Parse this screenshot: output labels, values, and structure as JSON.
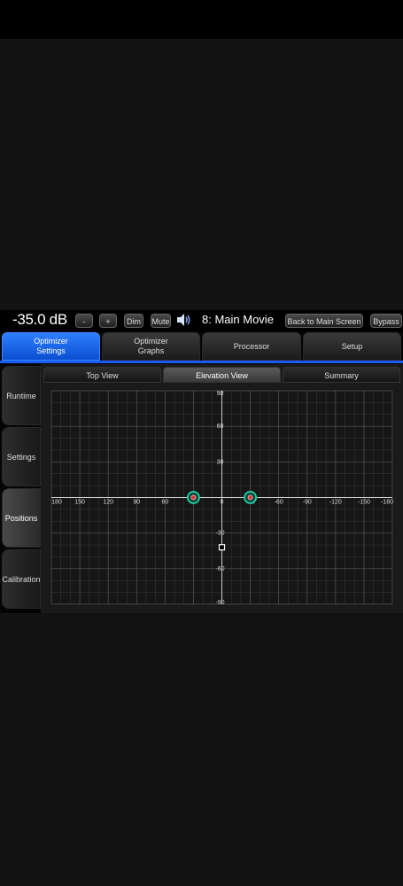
{
  "topbar": {
    "volume": "-35.0 dB",
    "minus_label": "-",
    "plus_label": "+",
    "dim_label": "Dim",
    "mute_label": "Mute",
    "preset": "8: Main Movie",
    "back_label": "Back to Main Screen",
    "bypass_label": "Bypass"
  },
  "main_tabs": [
    {
      "line1": "Optimizer",
      "line2": "Settings"
    },
    {
      "line1": "Optimizer",
      "line2": "Graphs"
    },
    {
      "line1": "Processor",
      "line2": ""
    },
    {
      "line1": "Setup",
      "line2": ""
    }
  ],
  "side_tabs": [
    "Runtime",
    "Settings",
    "Positions",
    "Calibration"
  ],
  "sub_tabs": [
    "Top View",
    "Elevation View",
    "Summary"
  ],
  "colors": {
    "accent": "#1a5cf0",
    "speaker_marker": "#1fc9a0",
    "speaker_center": "#e03030",
    "listener": "#ffffff"
  },
  "chart_data": {
    "type": "scatter",
    "title": "",
    "xlabel": "",
    "ylabel": "",
    "x_ticks": [
      "180",
      "150",
      "120",
      "90",
      "60",
      "30",
      "0",
      "-30",
      "-60",
      "-90",
      "-120",
      "-150",
      "-180"
    ],
    "y_ticks": [
      "90",
      "60",
      "30",
      "0",
      "-30",
      "-60",
      "-90"
    ],
    "xlim": [
      180,
      -180
    ],
    "ylim": [
      -90,
      90
    ],
    "grid": true,
    "series": [
      {
        "marker": "speaker",
        "points": [
          [
            30,
            0
          ],
          [
            -30,
            0
          ]
        ]
      },
      {
        "marker": "listener",
        "points": [
          [
            0,
            -42
          ]
        ]
      }
    ]
  }
}
